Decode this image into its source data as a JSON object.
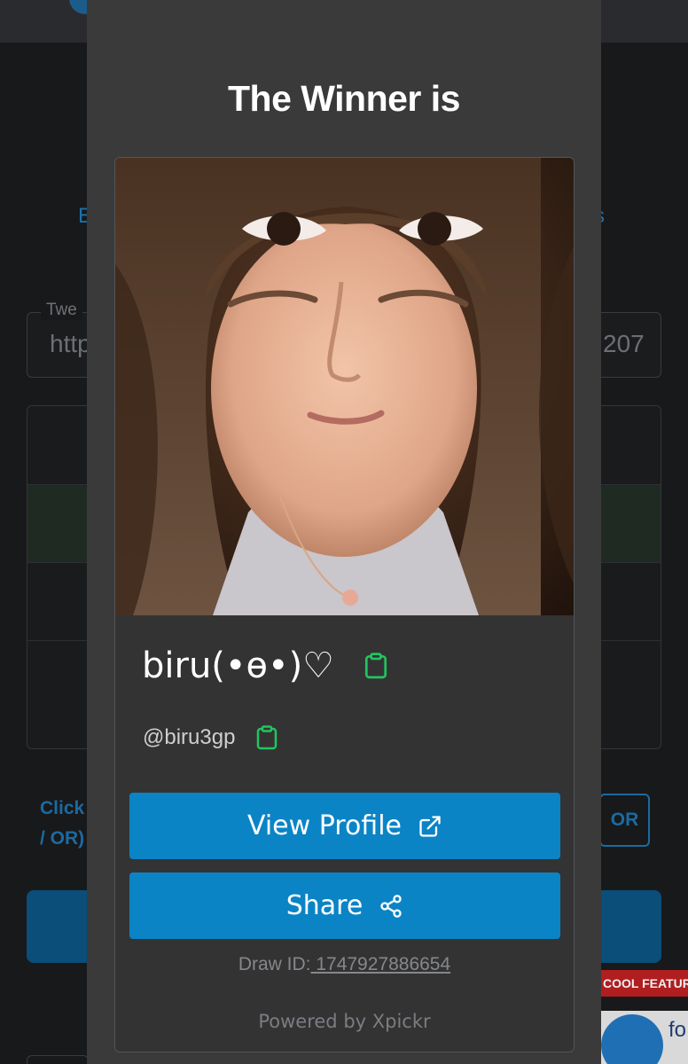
{
  "background": {
    "tab_left_fragment": "E",
    "tab_right_fragment": "s",
    "field_label_fragment": "Twe",
    "field_value_left": "http",
    "field_value_right": "207",
    "click_text_line1": "Click",
    "click_text_line2": "/ OR)",
    "or_button": "OR",
    "cool_badge": "COOL FEATUR",
    "promo_text_fragment": "fo"
  },
  "modal": {
    "title": "The Winner is",
    "winner": {
      "name": "biru(•ɵ•)♡",
      "handle": "@biru3gp"
    },
    "buttons": {
      "view_profile": "View Profile",
      "share": "Share"
    },
    "draw_id_label": "Draw ID:",
    "draw_id_value": " 1747927886654",
    "powered_by": "Powered by Xpickr"
  },
  "colors": {
    "accent": "#0b84c6",
    "copy_icon": "#22c55e",
    "modal_bg": "#3a3a3a"
  },
  "icons": {
    "copy": "clipboard-icon",
    "external": "external-link-icon",
    "share": "share-icon"
  }
}
